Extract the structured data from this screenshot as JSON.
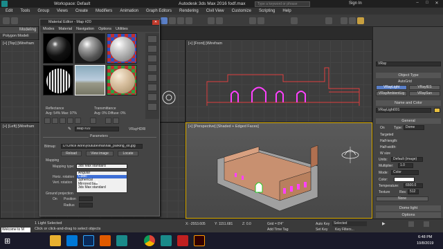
{
  "titlebar": {
    "workspace": "Workspace: Default",
    "app_title": "Autodesk 3ds Max 2016    fodf.max",
    "search_placeholder": "Type a keyword or phrase",
    "sign_in": "Sign In"
  },
  "menubar": [
    "Edit",
    "Tools",
    "Group",
    "Views",
    "Create",
    "Modifiers",
    "Animation",
    "Graph Editors",
    "Rendering",
    "Civil View",
    "Customize",
    "Scripting",
    "Help"
  ],
  "ribbon": {
    "modeling": "Modeling",
    "polygon": "Polygon Modeli"
  },
  "viewports": {
    "top": "[+] [Top] [Wirefram",
    "front": "[+] [Front] [Wirefram",
    "left": "[+] [Left] [Wirefram",
    "perspective": "[+] [Perspective] [Shaded + Edged Faces]"
  },
  "material_editor": {
    "title": "Material Editor - Map #20",
    "menu": [
      "Modes",
      "Material",
      "Navigation",
      "Options",
      "Utilities"
    ],
    "reflectance": "Reflectance",
    "reflectance_vals": "Avg: 54% Max: 97%",
    "transmittance": "Transmittance",
    "transmittance_vals": "Avg: 0% Diffuse: 0%",
    "map_name": "Map #20",
    "map_type": "VRayHDRI",
    "rollout": "Parameters",
    "bitmap_label": "Bitmap:",
    "bitmap_path": "D:\\Office work\\youtube\\mat\\hall_parking_lot.jpg",
    "reload": "Reload",
    "view_image": "View image",
    "locate": "Locate",
    "mapping_group": "Mapping",
    "mapping_type_label": "Mapping type:",
    "mapping_type": "3ds Max standard",
    "horiz_rotation": "Horiz. rotation",
    "vert_rotation": "Vert. rotation",
    "ground_projection": "Ground projection",
    "on": "On",
    "position": "Position",
    "radius": "Radius",
    "dropdown_options": [
      "Angular",
      "Cubic",
      "Spherical",
      "Mirrored ball",
      "3ds Max standard"
    ],
    "dropdown_selected": 1
  },
  "command_panel": {
    "object_name": "VRayLight001",
    "object_type": "Object Type",
    "autogrid": "AutoGrid",
    "buttons": [
      [
        "VRayLight",
        "VRayIES"
      ],
      [
        "VRayAmbientLig",
        "VRaySun"
      ]
    ],
    "name_and_color": "Name and Color",
    "renderer": "VRay",
    "general": "General",
    "on_label": "On",
    "type_label": "Type:",
    "type_value": "Dome",
    "targeted": "Targeted",
    "half_length": "Half-length:",
    "half_width": "Half-width:",
    "w_size": "W size",
    "units": "Units:",
    "units_value": "Default (image)",
    "multiplier": "Multiplier:",
    "multiplier_value": "1.0",
    "mode": "Mode:",
    "mode_value": "Color",
    "color": "Color:",
    "temperature": "Temperature:",
    "temperature_value": "6500.0",
    "texture": "Texture",
    "res": "Res:",
    "res_value": "512",
    "none": "None",
    "dome_light": "Dome light",
    "options": "Options"
  },
  "status": {
    "selection": "1 Light Selected",
    "prompt": "Click or click-and-drag to select objects",
    "x": "X: -2553.605",
    "y": "Y: 1151.681",
    "z": "Z: 0.0",
    "grid": "Grid = 8'4\"",
    "add_time_tag": "Add Time Tag",
    "auto_key": "Auto Key",
    "selected": "Selected",
    "set_key": "Set Key",
    "key_filters": "Key Filters...",
    "welcome": "Welcome to M"
  },
  "taskbar": {
    "time": "6:48 PM",
    "date": "10/8/2019"
  },
  "colors": {
    "accent": "#5a7fc7",
    "selected_viewport": "#e0b000",
    "model_walls": "#e04040",
    "arches": "#ff40ff"
  }
}
